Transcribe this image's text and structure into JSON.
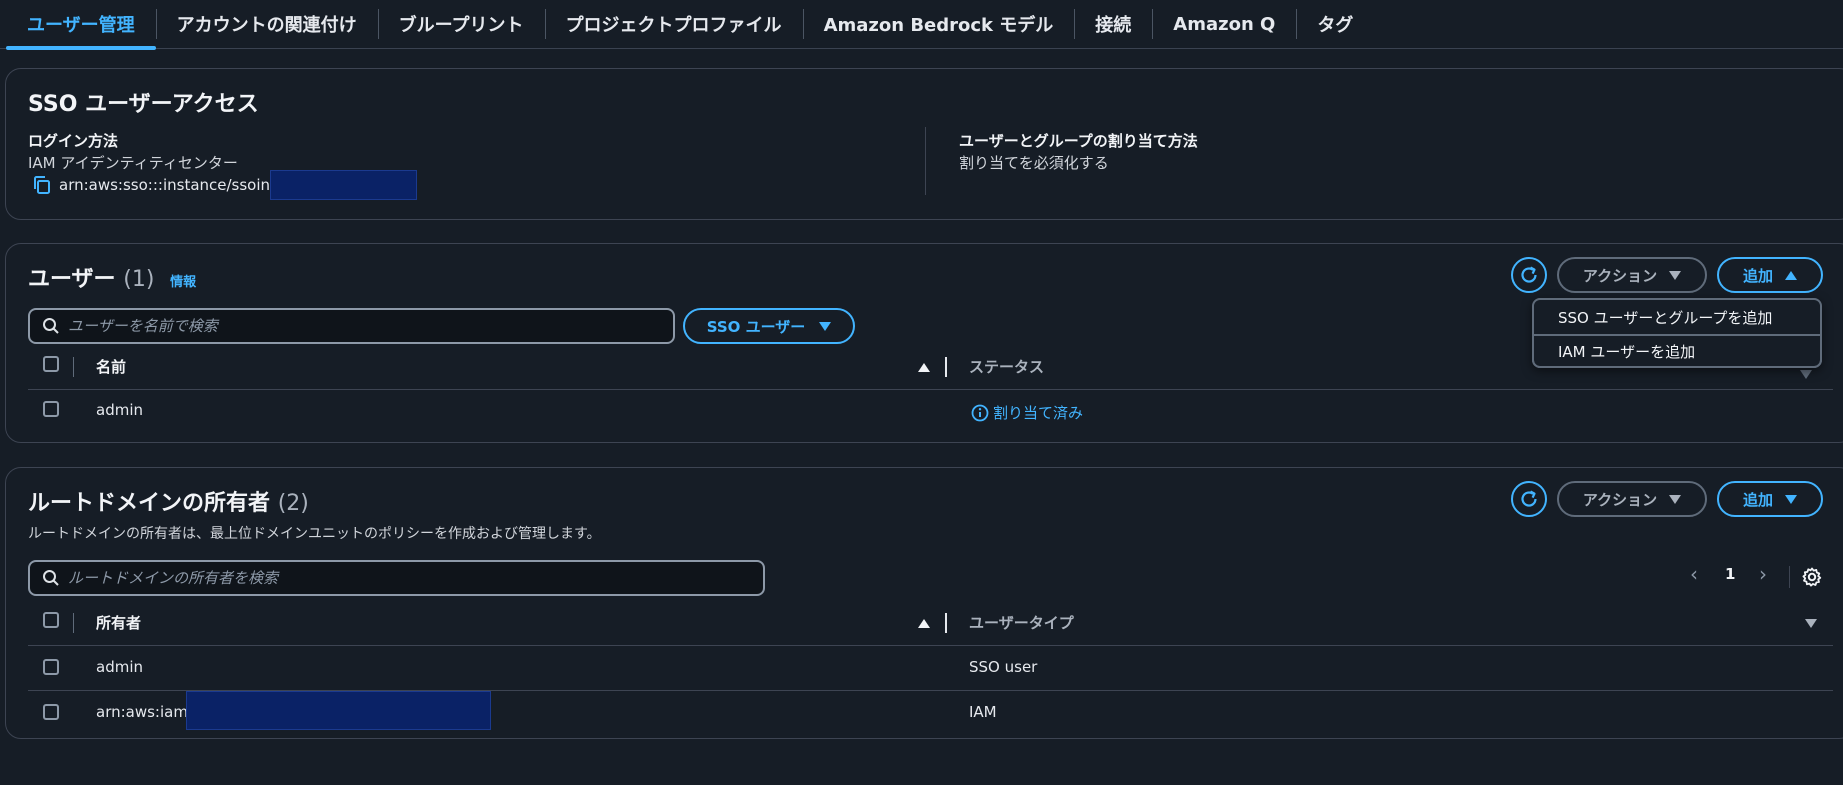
{
  "tabs": [
    {
      "label": "ユーザー管理",
      "active": true
    },
    {
      "label": "アカウントの関連付け"
    },
    {
      "label": "ブループリント"
    },
    {
      "label": "プロジェクトプロファイル"
    },
    {
      "label": "Amazon Bedrock モデル"
    },
    {
      "label": "接続"
    },
    {
      "label": "Amazon Q"
    },
    {
      "label": "タグ"
    }
  ],
  "sso_access": {
    "title": "SSO ユーザーアクセス",
    "login_method_label": "ログイン方法",
    "login_method_value": "IAM アイデンティティセンター",
    "arn_text": "arn:aws:sso:::instance/ssoins-",
    "assignment_label": "ユーザーとグループの割り当て方法",
    "assignment_value": "割り当てを必須化する"
  },
  "users": {
    "title": "ユーザー",
    "count": "(1)",
    "info_link": "情報",
    "actions_label": "アクション",
    "add_label": "追加",
    "search_placeholder": "ユーザーを名前で検索",
    "filter_label": "SSO ユーザー",
    "columns": [
      "名前",
      "ステータス"
    ],
    "rows": [
      {
        "name": "admin",
        "status": "割り当て済み"
      }
    ],
    "add_menu": [
      "SSO ユーザーとグループを追加",
      "IAM ユーザーを追加"
    ]
  },
  "owners": {
    "title": "ルートドメインの所有者",
    "count": "(2)",
    "description": "ルートドメインの所有者は、最上位ドメインユニットのポリシーを作成および管理します。",
    "actions_label": "アクション",
    "add_label": "追加",
    "search_placeholder": "ルートドメインの所有者を検索",
    "page": "1",
    "columns": [
      "所有者",
      "ユーザータイプ"
    ],
    "rows": [
      {
        "owner": "admin",
        "type": "SSO user"
      },
      {
        "owner": "arn:aws:iam:",
        "type": "IAM"
      }
    ]
  },
  "colors": {
    "accent": "#42b4ff",
    "background": "#161d26",
    "redaction": "#0a2266"
  }
}
